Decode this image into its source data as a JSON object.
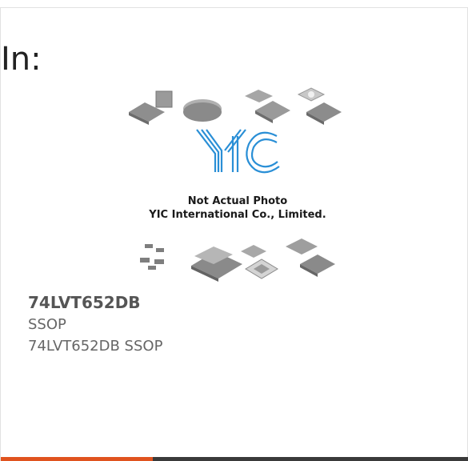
{
  "header": {
    "prefix": "In:"
  },
  "product": {
    "image": {
      "logo_text": "YIC",
      "caption_line1": "Not Actual Photo",
      "caption_line2": "YIC International Co., Limited."
    },
    "part_number": "74LVT652DB",
    "package": "SSOP",
    "description": "74LVT652DB SSOP"
  },
  "colors": {
    "accent": "#e0531f",
    "bar": "#3a3a3a",
    "logo": "#2a8fd6"
  }
}
